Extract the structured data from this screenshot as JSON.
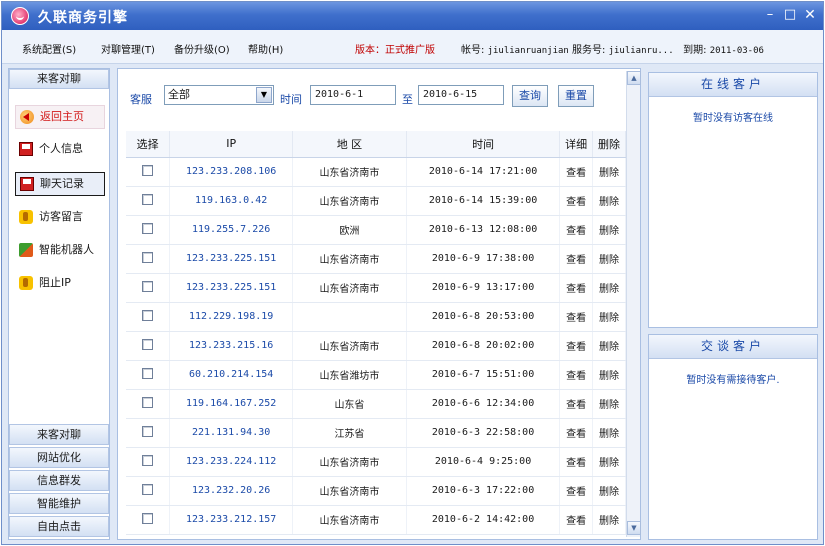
{
  "app": {
    "title": "久联商务引擎"
  },
  "window_controls": {
    "minimize": "–",
    "maximize": "□",
    "close": "✕"
  },
  "menu": {
    "system": "系统配置(S)",
    "chat": "对聊管理(T)",
    "backup": "备份升级(O)",
    "help": "帮助(H)"
  },
  "status": {
    "version": "版本：正式推广版",
    "account_label": "帐号:",
    "account": "jiulianruanjian",
    "service_label": "服务号:",
    "service": "jiulianru...",
    "expiry_label": "到期:",
    "expiry": "2011-03-06"
  },
  "sidebar": {
    "header": "来客对聊",
    "items": [
      {
        "label": "返回主页",
        "icon": "home-arrow-icon"
      },
      {
        "label": "个人信息",
        "icon": "save-disk-icon"
      },
      {
        "label": "聊天记录",
        "icon": "save-disk-icon"
      },
      {
        "label": "访客留言",
        "icon": "person-icon"
      },
      {
        "label": "智能机器人",
        "icon": "robot-icon"
      },
      {
        "label": "阻止IP",
        "icon": "person-icon"
      }
    ],
    "footer": [
      "来客对聊",
      "网站优化",
      "信息群发",
      "智能维护",
      "自由点击"
    ]
  },
  "filter": {
    "agent_label": "客服",
    "agent_value": "全部",
    "time_label": "时间",
    "from": "2010-6-1",
    "to_label": "至",
    "to": "2010-6-15",
    "search": "查询",
    "reset": "重置"
  },
  "table": {
    "columns": [
      "选择",
      "IP",
      "地 区",
      "时间",
      "详细",
      "删除"
    ],
    "view_label": "查看",
    "delete_label": "删除",
    "rows": [
      {
        "ip": "123.233.208.106",
        "region": "山东省济南市",
        "time": "2010-6-14 17:21:00"
      },
      {
        "ip": "119.163.0.42",
        "region": "山东省济南市",
        "time": "2010-6-14 15:39:00"
      },
      {
        "ip": "119.255.7.226",
        "region": "欧洲",
        "time": "2010-6-13 12:08:00"
      },
      {
        "ip": "123.233.225.151",
        "region": "山东省济南市",
        "time": "2010-6-9 17:38:00"
      },
      {
        "ip": "123.233.225.151",
        "region": "山东省济南市",
        "time": "2010-6-9 13:17:00"
      },
      {
        "ip": "112.229.198.19",
        "region": "",
        "time": "2010-6-8 20:53:00"
      },
      {
        "ip": "123.233.215.16",
        "region": "山东省济南市",
        "time": "2010-6-8 20:02:00"
      },
      {
        "ip": "60.210.214.154",
        "region": "山东省潍坊市",
        "time": "2010-6-7 15:51:00"
      },
      {
        "ip": "119.164.167.252",
        "region": "山东省",
        "time": "2010-6-6 12:34:00"
      },
      {
        "ip": "221.131.94.30",
        "region": "江苏省",
        "time": "2010-6-3 22:58:00"
      },
      {
        "ip": "123.233.224.112",
        "region": "山东省济南市",
        "time": "2010-6-4 9:25:00"
      },
      {
        "ip": "123.232.20.26",
        "region": "山东省济南市",
        "time": "2010-6-3 17:22:00"
      },
      {
        "ip": "123.233.212.157",
        "region": "山东省济南市",
        "time": "2010-6-2 14:42:00"
      }
    ]
  },
  "online_panel": {
    "title": "在线客户",
    "empty": "暂时没有访客在线"
  },
  "talk_panel": {
    "title": "交谈客户",
    "empty": "暂时没有需接待客户."
  },
  "colors": {
    "titlebar": "#3f6fcc",
    "accent_blue": "#1b4aa8",
    "version_red": "#c00000",
    "home_red": "#d21a1a"
  }
}
